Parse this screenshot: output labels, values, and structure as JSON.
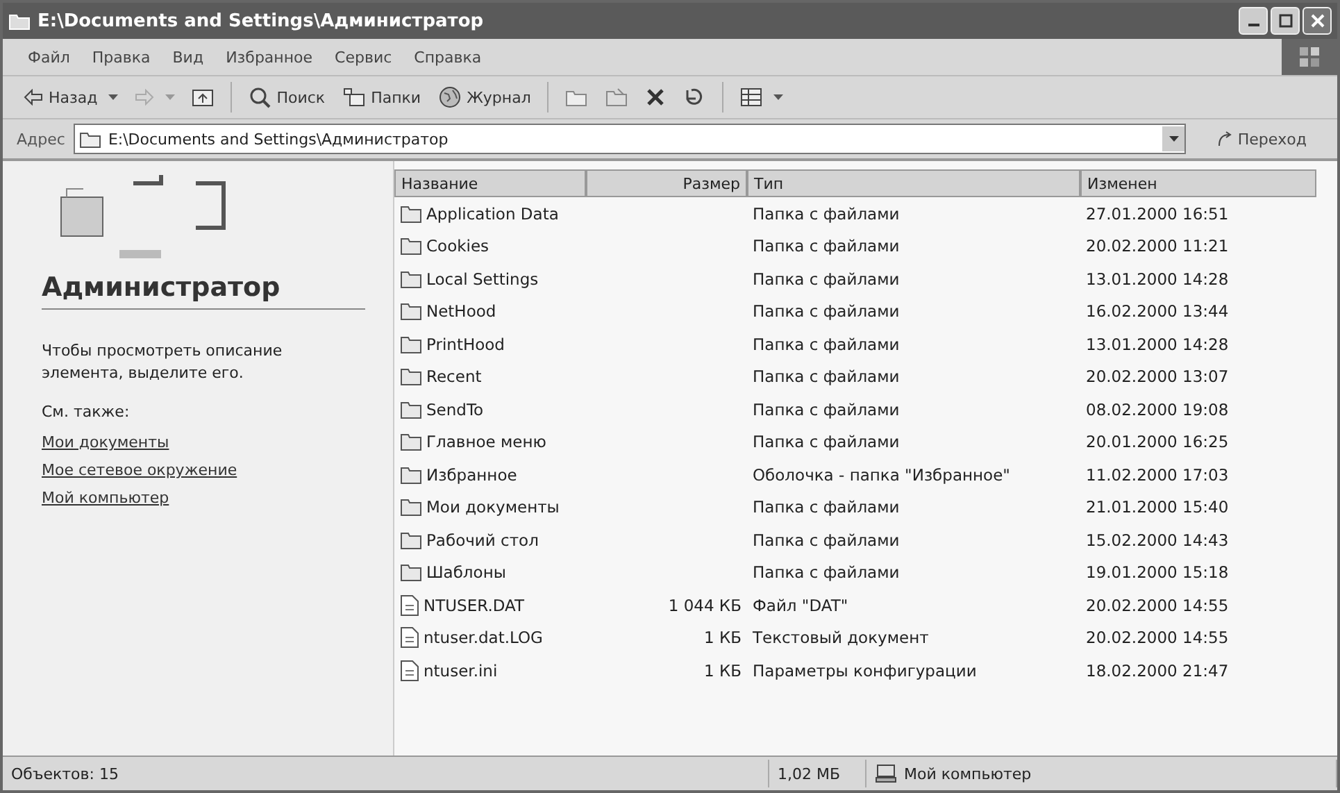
{
  "window": {
    "title": "E:\\Documents and Settings\\Администратор"
  },
  "menu": [
    "Файл",
    "Правка",
    "Вид",
    "Избранное",
    "Сервис",
    "Справка"
  ],
  "toolbar": {
    "back": "Назад",
    "forward_disabled": true,
    "search": "Поиск",
    "folders": "Папки",
    "history": "Журнал"
  },
  "address": {
    "label": "Адрес",
    "value": "E:\\Documents and Settings\\Администратор",
    "go": "Переход"
  },
  "sidebar": {
    "title": "Администратор",
    "hint": "Чтобы просмотреть описание элемента, выделите его.",
    "see_also": "См. также:",
    "links": [
      "Мои документы",
      "Мое сетевое окружение",
      "Мой компьютер"
    ]
  },
  "table": {
    "columns": [
      "Название",
      "Размер",
      "Тип",
      "Изменен"
    ],
    "rows": [
      {
        "kind": "folder",
        "name": "Application Data",
        "type": "Папка с файлами",
        "modified": "27.01.2000 16:51"
      },
      {
        "kind": "folder",
        "name": "Cookies",
        "type": "Папка с файлами",
        "modified": "20.02.2000 11:21"
      },
      {
        "kind": "folder",
        "name": "Local Settings",
        "type": "Папка с файлами",
        "modified": "13.01.2000 14:28"
      },
      {
        "kind": "folder",
        "name": "NetHood",
        "type": "Папка с файлами",
        "modified": "16.02.2000 13:44"
      },
      {
        "kind": "folder",
        "name": "PrintHood",
        "type": "Папка с файлами",
        "modified": "13.01.2000 14:28"
      },
      {
        "kind": "folder",
        "name": "Recent",
        "type": "Папка с файлами",
        "modified": "20.02.2000 13:07"
      },
      {
        "kind": "folder",
        "name": "SendTo",
        "type": "Папка с файлами",
        "modified": "08.02.2000 19:08"
      },
      {
        "kind": "folder",
        "name": "Главное меню",
        "type": "Папка с файлами",
        "modified": "20.01.2000 16:25"
      },
      {
        "kind": "folder",
        "name": "Избранное",
        "type": "Оболочка - папка \"Избранное\"",
        "modified": "11.02.2000 17:03"
      },
      {
        "kind": "folder",
        "name": "Мои документы",
        "type": "Папка с файлами",
        "modified": "21.01.2000 15:40"
      },
      {
        "kind": "folder",
        "name": "Рабочий стол",
        "type": "Папка с файлами",
        "modified": "15.02.2000 14:43"
      },
      {
        "kind": "folder",
        "name": "Шаблоны",
        "type": "Папка с файлами",
        "modified": "19.01.2000 15:18"
      },
      {
        "kind": "file",
        "name": "NTUSER.DAT",
        "size": "1 044 КБ",
        "type": "Файл \"DAT\"",
        "modified": "20.02.2000 14:55"
      },
      {
        "kind": "file",
        "name": "ntuser.dat.LOG",
        "size": "1 КБ",
        "type": "Текстовый документ",
        "modified": "20.02.2000 14:55"
      },
      {
        "kind": "file",
        "name": "ntuser.ini",
        "size": "1 КБ",
        "type": "Параметры конфигурации",
        "modified": "18.02.2000 21:47"
      }
    ]
  },
  "status_bar": {
    "count": "Объектов: 15",
    "size": "1,02 МБ",
    "location": "Мой компьютер"
  }
}
